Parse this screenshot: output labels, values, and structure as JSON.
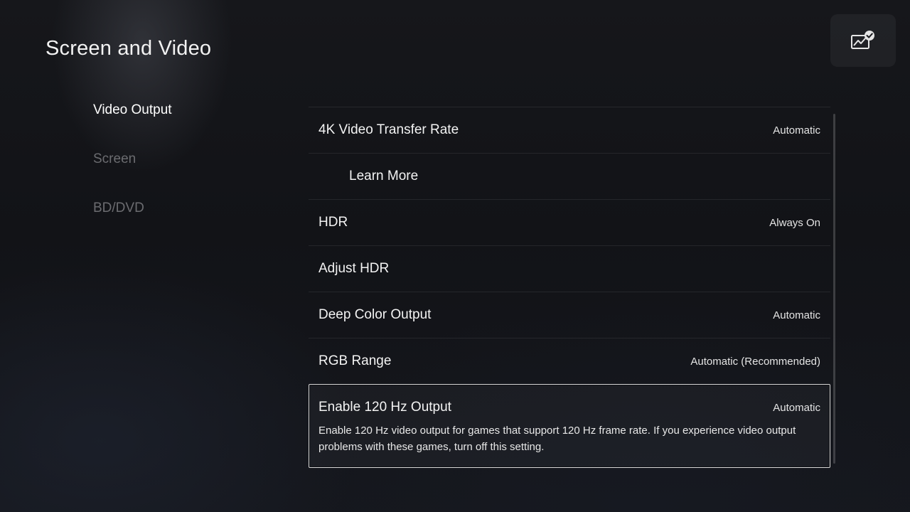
{
  "header": {
    "title": "Screen and Video",
    "status_icon": "display-check-icon"
  },
  "sidebar": {
    "items": [
      {
        "label": "Video Output",
        "active": true
      },
      {
        "label": "Screen",
        "active": false
      },
      {
        "label": "BD/DVD",
        "active": false
      }
    ]
  },
  "settings": {
    "items": [
      {
        "label": "4K Video Transfer Rate",
        "value": "Automatic"
      },
      {
        "label": "Learn More",
        "value": ""
      },
      {
        "label": "HDR",
        "value": "Always On"
      },
      {
        "label": "Adjust HDR",
        "value": ""
      },
      {
        "label": "Deep Color Output",
        "value": "Automatic"
      },
      {
        "label": "RGB Range",
        "value": "Automatic (Recommended)"
      },
      {
        "label": "Enable 120 Hz Output",
        "value": "Automatic",
        "description": "Enable 120 Hz video output for games that support 120 Hz frame rate. If you experience video output problems with these games, turn off this setting.",
        "focused": true
      }
    ]
  },
  "colors": {
    "background": "#131418",
    "text_primary": "#ffffff",
    "text_inactive": "#6b6c70",
    "focus_border": "#d8d8d8"
  }
}
